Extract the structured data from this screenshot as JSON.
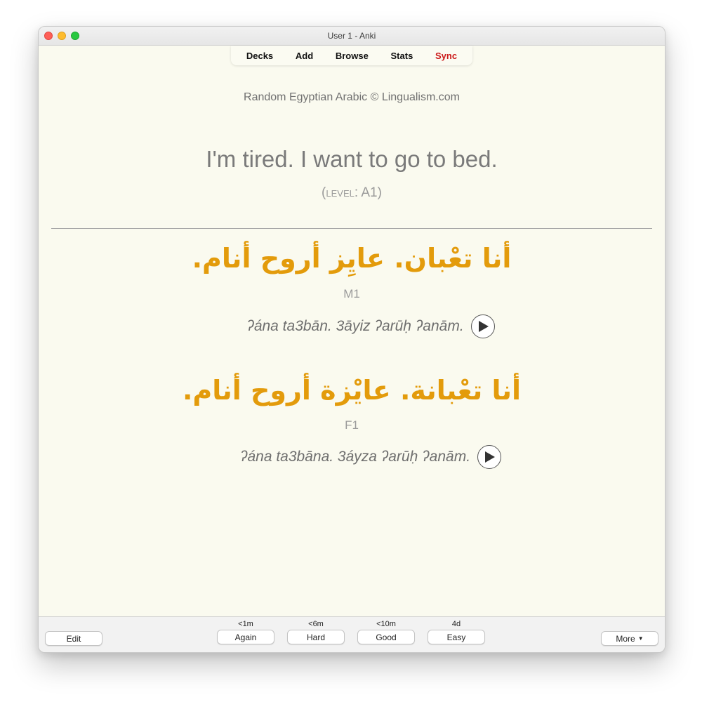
{
  "window": {
    "title": "User 1 - Anki"
  },
  "toolbar": {
    "decks": "Decks",
    "add": "Add",
    "browse": "Browse",
    "stats": "Stats",
    "sync": "Sync"
  },
  "card": {
    "source": "Random Egyptian Arabic © Lingualism.com",
    "english": "I'm tired. I want to go to bed.",
    "level_open": "(",
    "level_word": "level",
    "level_value": ": A1)",
    "m1": {
      "arabic": "أنا تعْبان. عايِز أروح أنام.",
      "tag": "M1",
      "translit": "ʔána ta3bān. 3āyiz ʔarūḥ ʔanām."
    },
    "f1": {
      "arabic": "أنا تعْبانة. عايْزة أروح أنام.",
      "tag": "F1",
      "translit": "ʔána ta3bāna. 3áyza ʔarūḥ ʔanām."
    }
  },
  "bottombar": {
    "edit": "Edit",
    "more": "More",
    "again": {
      "due": "<1m",
      "label": "Again"
    },
    "hard": {
      "due": "<6m",
      "label": "Hard"
    },
    "good": {
      "due": "<10m",
      "label": "Good"
    },
    "easy": {
      "due": "4d",
      "label": "Easy"
    }
  },
  "colors": {
    "card_background": "#fafaef",
    "arabic": "#e39b0b",
    "sync": "#cc1a1a",
    "text_gray": "#7a7a7a"
  },
  "icons": {
    "play": "play-icon",
    "more_caret": "caret-down-icon"
  }
}
